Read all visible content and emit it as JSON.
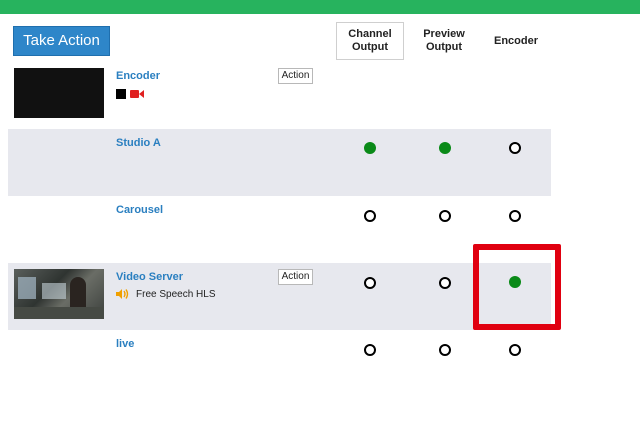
{
  "toolbar": {
    "take_action_label": "Take Action"
  },
  "columns": [
    {
      "label": "Channel Output",
      "active": true
    },
    {
      "label": "Preview Output",
      "active": false
    },
    {
      "label": "Encoder",
      "active": false
    }
  ],
  "sources": [
    {
      "name": "Encoder",
      "has_action": true,
      "action_label": "Action",
      "thumb": "black",
      "icons": [
        "stop-square-icon",
        "video-camera-icon"
      ],
      "states": [
        null,
        null,
        null
      ]
    },
    {
      "name": "Studio A",
      "has_action": false,
      "thumb": "none",
      "states": [
        true,
        true,
        false
      ]
    },
    {
      "name": "Carousel",
      "has_action": false,
      "thumb": "none",
      "states": [
        false,
        false,
        false
      ]
    },
    {
      "name": "Video Server",
      "has_action": true,
      "action_label": "Action",
      "thumb": "video",
      "subtitle": "Free Speech HLS",
      "subtitle_icon": "audio-speaker-icon",
      "states": [
        false,
        false,
        true
      ]
    },
    {
      "name": "live",
      "has_action": false,
      "thumb": "none",
      "states": [
        false,
        false,
        false
      ]
    }
  ],
  "colors": {
    "header_green": "#27b35e",
    "button_blue": "#2e86c9",
    "link_blue": "#2a7fc0",
    "row_shade": "#e7e8ee",
    "radio_on_green": "#0a8a18",
    "highlight_red": "#e00010"
  }
}
